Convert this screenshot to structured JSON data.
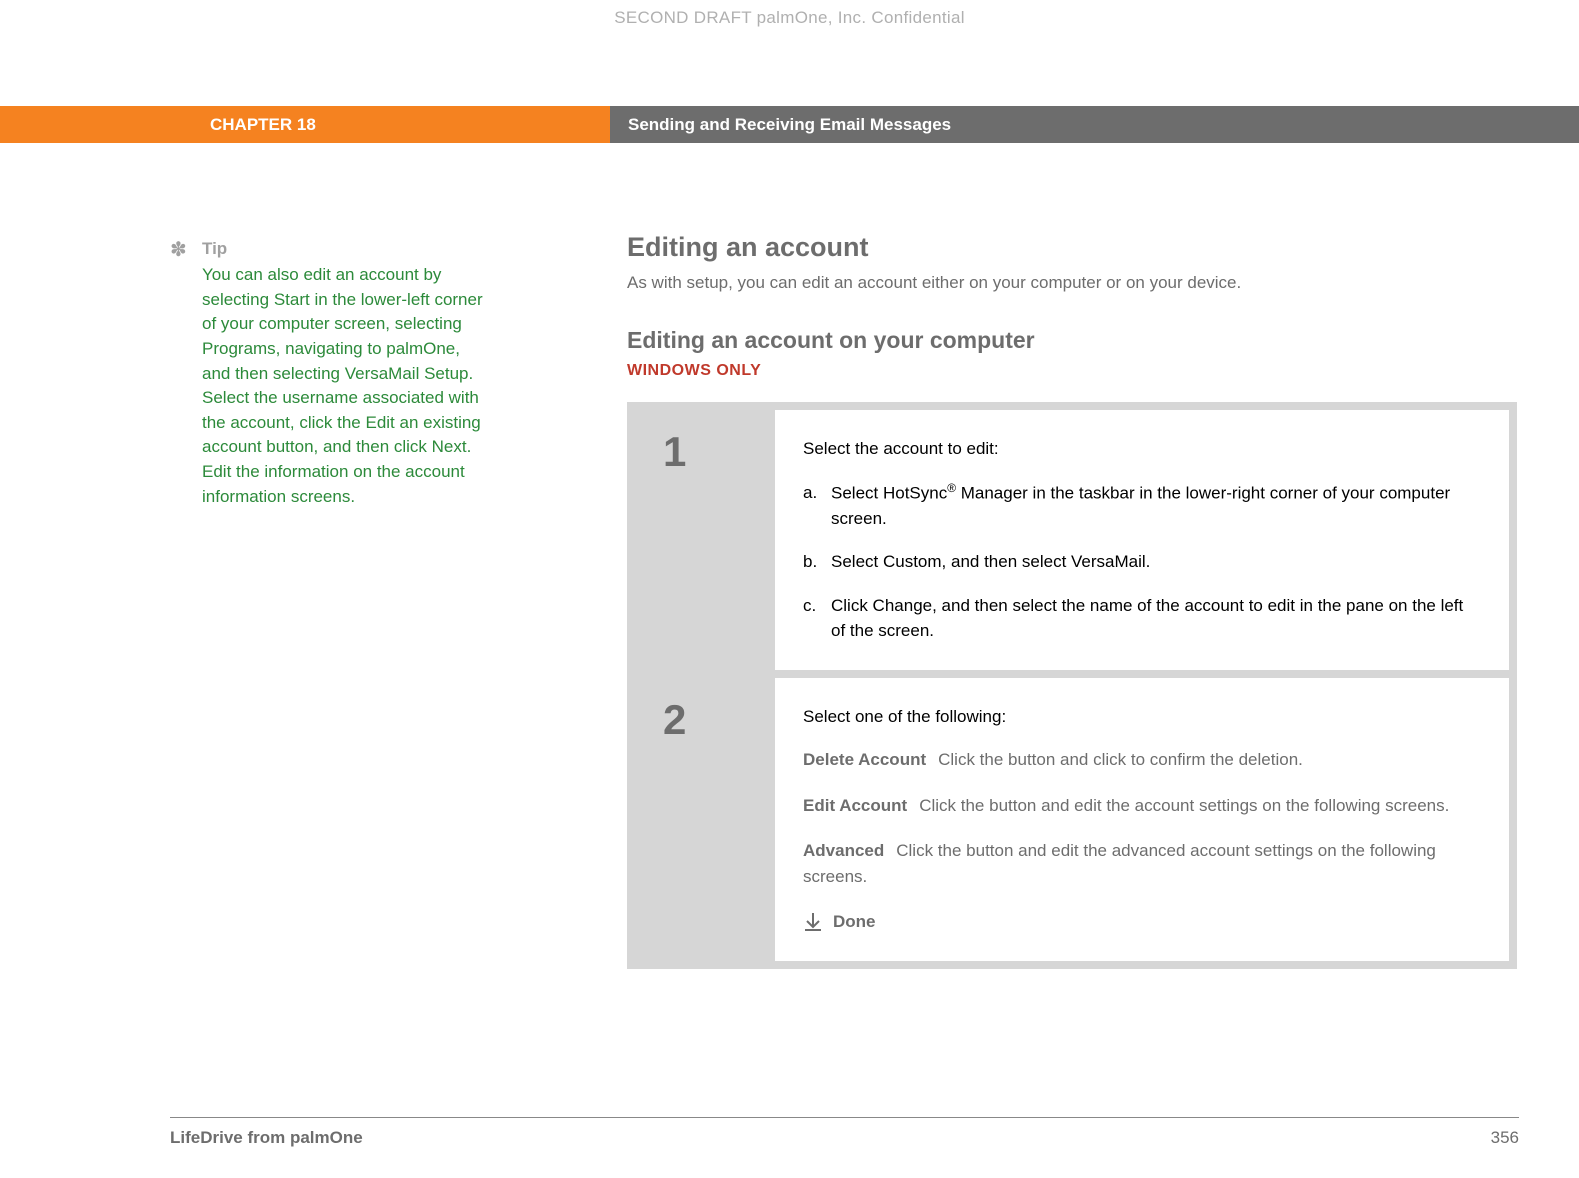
{
  "draft_header": "SECOND DRAFT palmOne, Inc.  Confidential",
  "banner": {
    "chapter": "CHAPTER 18",
    "title": "Sending and Receiving Email Messages"
  },
  "tip": {
    "label": "Tip",
    "body": "You can also edit an account by selecting Start in the lower-left corner of your computer screen, selecting Programs, navigating to palmOne, and then selecting VersaMail Setup. Select the username associated with the account, click the Edit an existing account button, and then click Next. Edit the information on the account information screens."
  },
  "main": {
    "h1": "Editing an account",
    "intro": "As with setup, you can edit an account either on your computer or on your device.",
    "h2": "Editing an account on your computer",
    "platform": "WINDOWS ONLY"
  },
  "steps": [
    {
      "num": "1",
      "lead": "Select the account to edit:",
      "subs": [
        {
          "letter": "a.",
          "text_pre": "Select HotSync",
          "reg": "®",
          "text_post": " Manager in the taskbar in the lower-right corner of your computer screen."
        },
        {
          "letter": "b.",
          "text": "Select Custom, and then select VersaMail."
        },
        {
          "letter": "c.",
          "text": "Click Change, and then select the name of the account to edit in the pane on the left of the screen."
        }
      ]
    },
    {
      "num": "2",
      "lead": "Select one of the following:",
      "options": [
        {
          "label": "Delete Account",
          "desc": "Click the button and click to confirm the deletion."
        },
        {
          "label": "Edit Account",
          "desc": "Click the button and edit the account settings on the following screens."
        },
        {
          "label": "Advanced",
          "desc": "Click the button and edit the advanced account settings on the following screens."
        }
      ],
      "done": "Done"
    }
  ],
  "footer": {
    "left": "LifeDrive from palmOne",
    "right": "356"
  }
}
